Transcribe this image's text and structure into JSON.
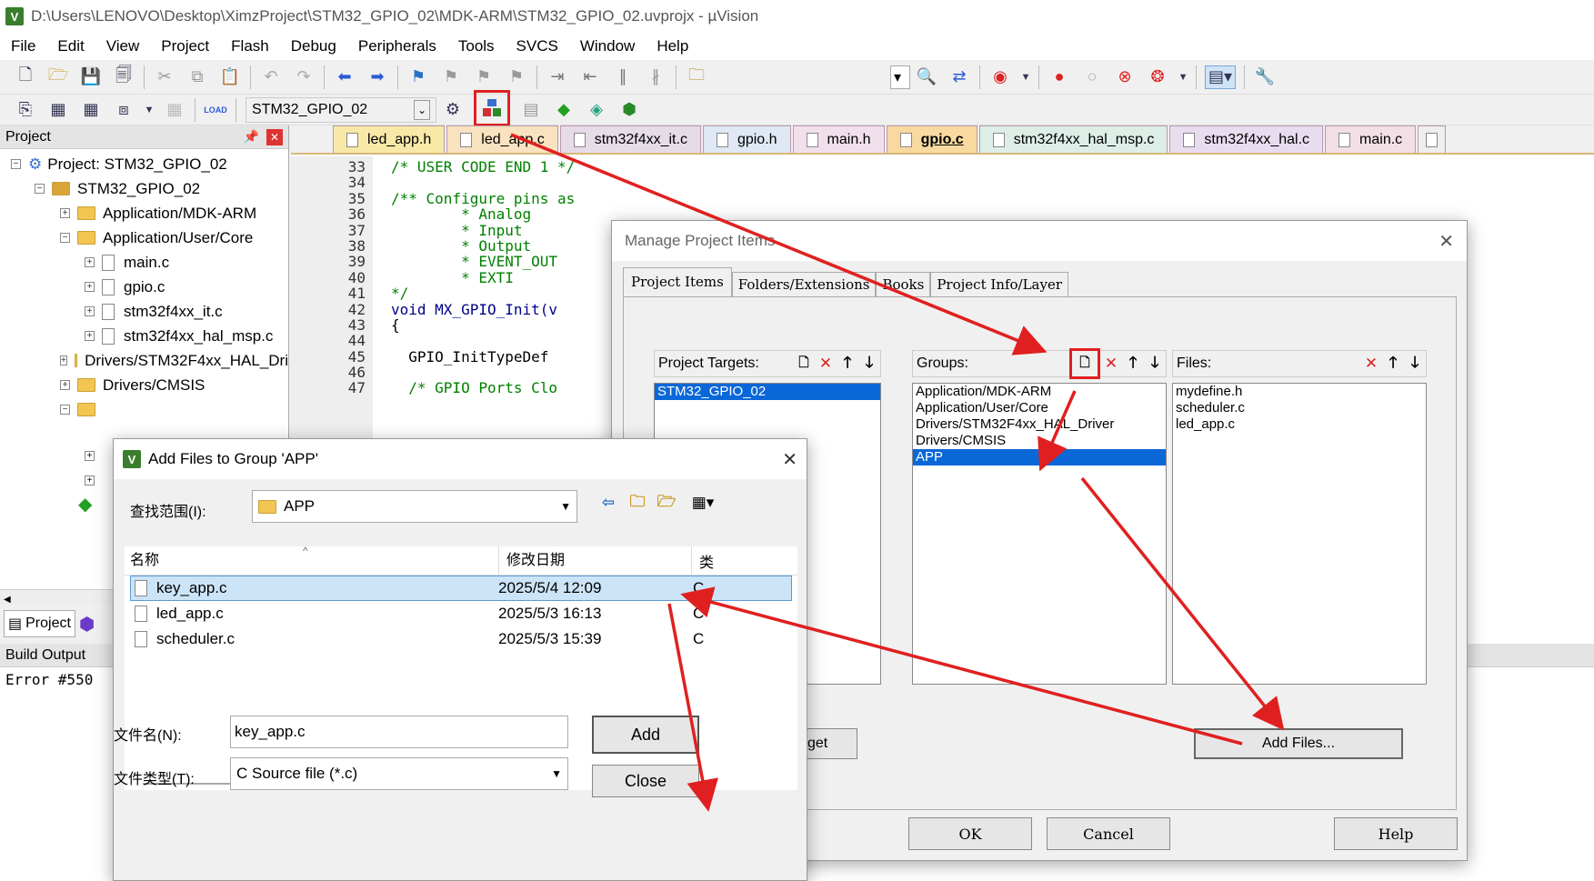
{
  "window": {
    "title": "D:\\Users\\LENOVO\\Desktop\\XimzProject\\STM32_GPIO_02\\MDK-ARM\\STM32_GPIO_02.uvprojx - µVision",
    "icon_text": "V"
  },
  "menu": [
    "File",
    "Edit",
    "View",
    "Project",
    "Flash",
    "Debug",
    "Peripherals",
    "Tools",
    "SVCS",
    "Window",
    "Help"
  ],
  "toolbar2": {
    "target": "STM32_GPIO_02",
    "load_label": "LOAD"
  },
  "project_panel": {
    "title": "Project",
    "root": "Project: STM32_GPIO_02",
    "target": "STM32_GPIO_02",
    "groups": [
      "Application/MDK-ARM",
      "Application/User/Core",
      "Drivers/STM32F4xx_HAL_Dri",
      "Drivers/CMSIS"
    ],
    "core_files": [
      "main.c",
      "gpio.c",
      "stm32f4xx_it.c",
      "stm32f4xx_hal_msp.c"
    ],
    "bottom_tab": "Project"
  },
  "build_output": {
    "title": "Build Output",
    "text": "Error #550"
  },
  "editor": {
    "tabs": [
      "led_app.h",
      "led_app.c",
      "stm32f4xx_it.c",
      "gpio.h",
      "main.h",
      "gpio.c",
      "stm32f4xx_hal_msp.c",
      "stm32f4xx_hal.c",
      "main.c"
    ],
    "active_tab": "gpio.c",
    "lines": [
      {
        "n": "33",
        "code": "/* USER CODE END 1 */",
        "cls": "cm"
      },
      {
        "n": "34",
        "code": "",
        "cls": ""
      },
      {
        "n": "35",
        "code": "/** Configure pins as",
        "cls": "cm"
      },
      {
        "n": "36",
        "code": "        * Analog",
        "cls": "cm"
      },
      {
        "n": "37",
        "code": "        * Input",
        "cls": "cm"
      },
      {
        "n": "38",
        "code": "        * Output",
        "cls": "cm"
      },
      {
        "n": "39",
        "code": "        * EVENT_OUT",
        "cls": "cm"
      },
      {
        "n": "40",
        "code": "        * EXTI",
        "cls": "cm"
      },
      {
        "n": "41",
        "code": "*/",
        "cls": "cm"
      },
      {
        "n": "42",
        "code": "void MX_GPIO_Init(v",
        "cls": "kw"
      },
      {
        "n": "43",
        "code": "{",
        "cls": ""
      },
      {
        "n": "44",
        "code": "",
        "cls": ""
      },
      {
        "n": "45",
        "code": "  GPIO_InitTypeDef",
        "cls": ""
      },
      {
        "n": "46",
        "code": "",
        "cls": ""
      },
      {
        "n": "47",
        "code": "  /* GPIO Ports Clo",
        "cls": "cm"
      }
    ]
  },
  "manage_dialog": {
    "title": "Manage Project Items",
    "tabs": [
      "Project Items",
      "Folders/Extensions",
      "Books",
      "Project Info/Layer"
    ],
    "targets_label": "Project Targets:",
    "targets": [
      "STM32_GPIO_02"
    ],
    "groups_label": "Groups:",
    "groups": [
      "Application/MDK-ARM",
      "Application/User/Core",
      "Drivers/STM32F4xx_HAL_Driver",
      "Drivers/CMSIS",
      "APP"
    ],
    "selected_group": "APP",
    "files_label": "Files:",
    "files": [
      "mydefine.h",
      "scheduler.c",
      "led_app.c"
    ],
    "set_target_label": "Target",
    "add_files_label": "Add Files...",
    "ok": "OK",
    "cancel": "Cancel",
    "help": "Help"
  },
  "add_dialog": {
    "title": "Add Files to Group 'APP'",
    "lookin_label": "查找范围(I):",
    "lookin_value": "APP",
    "col_name": "名称",
    "col_date": "修改日期",
    "col_type": "类",
    "rows": [
      {
        "name": "key_app.c",
        "date": "2025/5/4 12:09",
        "type": "C"
      },
      {
        "name": "led_app.c",
        "date": "2025/5/3 16:13",
        "type": "C"
      },
      {
        "name": "scheduler.c",
        "date": "2025/5/3 15:39",
        "type": "C"
      }
    ],
    "filename_label": "文件名(N):",
    "filename_value": "key_app.c",
    "filetype_label": "文件类型(T):",
    "filetype_value": "C Source file (*.c)",
    "add": "Add",
    "close": "Close"
  },
  "colors": {
    "annotation": "#e02020",
    "selection": "#0a67d8"
  }
}
